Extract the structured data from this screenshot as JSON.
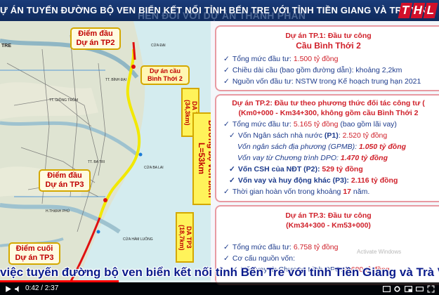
{
  "ticker": {
    "text": "Ự ÁN TUYẾN ĐƯỜNG BỘ VEN BIỂN KẾT NỐI TỈNH BẾN TRE VỚI TỈNH TIỀN GIANG VÀ TRÀ VINH",
    "overlay": "HEN    ĐỐI VỚI DỰ ÁN THÀNH PHẦN",
    "logo": [
      "T",
      "H",
      "L"
    ]
  },
  "map": {
    "start_tp2": "Điểm đầu\nDự án TP2",
    "tp2_label": "Dự án cầu\nBình Thới 2",
    "start_tp3": "Điểm đầu\nDự án TP3",
    "end_tp3": "Điểm cuối\nDự án TP3",
    "da_tp2": "DA TP2\n(34,3km)",
    "coastal_road": "Đường bộ ven biển\nL=53km",
    "da_tp3": "DA TP3\n(18,7km)",
    "place_tre": "TRE",
    "place_giaotrom": "TT. GIỒNG TRÔM",
    "place_batri": "TT. BA TRI",
    "place_binhdai": "TT. BÌNH ĐẠI",
    "place_thanhphu": "H.THẠNH PHÚ",
    "place_cuadai": "CỬA ĐẠI",
    "place_cuahamluong": "CỬA HÀM LUÔNG",
    "place_cuabalai": "CỬA BA LAI"
  },
  "panel": {
    "tp1": {
      "title_a": "Dự án TP.1: Đầu tư công",
      "title_b": "Cầu Bình Thới 2",
      "line1_prefix": "Tổng mức đầu tư: ",
      "line1_value": "1.500 tỷ đồng",
      "line2": "Chiều dài cầu (bao gồm đường dẫn): khoảng 2,2km",
      "line3": "Nguồn vốn đầu tư: NSTW trong Kế hoạch trung hạn 2021"
    },
    "tp2": {
      "title_a": "Dự án TP.2: Đầu tư theo phương thức đối tác công tư (",
      "title_b": "(Km0+000 - Km34+300, không gồm cầu Bình Thới 2",
      "line1_prefix": "Tổng mức đầu tư: ",
      "line1_value": "5.165 tỷ đồng",
      "line1_suffix": " (bao gồm lãi vay)",
      "line2_prefix": "Vốn Ngân sách nhà nước ",
      "line2_bold": "(P1)",
      "line2_mid": ": ",
      "line2_value": "2.520 tỷ đồng",
      "line3_prefix": "Vốn ngân sách địa phương (GPMB): ",
      "line3_value": "1.050 tỷ đồng",
      "line4_prefix": "Vốn vay từ Chương trình DPO: ",
      "line4_value": "1.470 tỷ đồng",
      "line5_prefix": "Vốn CSH của NĐT (P2): ",
      "line5_value": "529 tỷ đồng",
      "line6_prefix": "Vốn vay và huy động khác (P3): ",
      "line6_value": "2.116 tỷ đồng",
      "line7_prefix": "Thời gian hoàn vốn trong khoảng ",
      "line7_value": "17",
      "line7_suffix": " năm."
    },
    "tp3": {
      "title_a": "Dự án TP.3: Đầu tư công",
      "title_b": "(Km34+300 - Km53+000)",
      "line1_prefix": "Tổng mức đầu tư: ",
      "line1_value": "6.758 tỷ đồng",
      "line2": "Cơ cấu nguồn vốn:",
      "line3_prefix": "Vốn vay từ Chương trình DPO: ",
      "line3_value": "4.680 tỷ đồng"
    }
  },
  "watermark": "Activate Windows",
  "subtitle": " việc tuyến đường bộ ven biển kết nối tỉnh Bến Tre với tỉnh Tiền Giang và Trà Vinh",
  "player": {
    "time": "0:42 / 2:37",
    "progress": 0.27
  },
  "colors": {
    "ticker_bg": "#1a3c7a",
    "accent_red": "#d0202a",
    "text_blue": "#1d3b8c",
    "box_border": "#d4a800"
  }
}
